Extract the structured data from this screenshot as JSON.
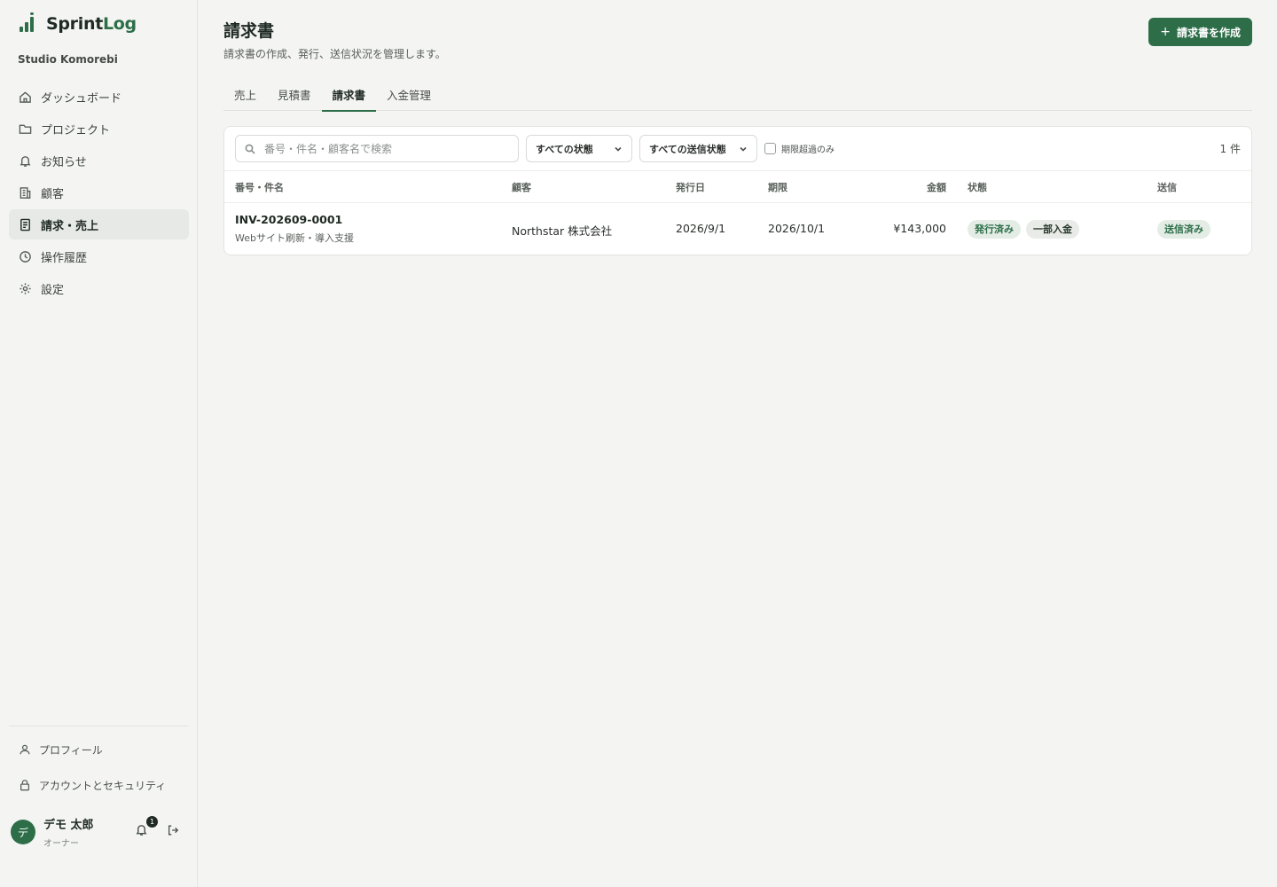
{
  "brand": {
    "name_part1": "Sprint",
    "name_part2": "Log",
    "org": "Studio Komorebi"
  },
  "nav": [
    {
      "label": "ダッシュボード",
      "icon": "home-icon"
    },
    {
      "label": "プロジェクト",
      "icon": "folder-icon"
    },
    {
      "label": "お知らせ",
      "icon": "bell-icon"
    },
    {
      "label": "顧客",
      "icon": "building-icon"
    },
    {
      "label": "請求・売上",
      "icon": "receipt-icon",
      "active": true
    },
    {
      "label": "操作履歴",
      "icon": "clock-icon"
    },
    {
      "label": "設定",
      "icon": "gear-icon"
    }
  ],
  "bottom_nav": [
    {
      "label": "プロフィール",
      "icon": "user-icon"
    },
    {
      "label": "アカウントとセキュリティ",
      "icon": "lock-icon"
    }
  ],
  "user": {
    "initial": "デ",
    "name": "デモ 太郎",
    "role": "オーナー",
    "notifications": "1"
  },
  "page": {
    "title": "請求書",
    "subtitle": "請求書の作成、発行、送信状況を管理します。",
    "create_button": "請求書を作成",
    "create_icon": "+"
  },
  "tabs": [
    {
      "label": "売上"
    },
    {
      "label": "見積書"
    },
    {
      "label": "請求書",
      "active": true
    },
    {
      "label": "入金管理"
    }
  ],
  "filters": {
    "search_placeholder": "番号・件名・顧客名で検索",
    "status_select": "すべての状態",
    "send_status_select": "すべての送信状態",
    "overdue_label": "期限超過のみ",
    "count": "1 件"
  },
  "table": {
    "headers": {
      "number": "番号・件名",
      "customer": "顧客",
      "issued": "発行日",
      "due": "期限",
      "amount": "金額",
      "status": "状態",
      "send": "送信"
    },
    "rows": [
      {
        "number": "INV-202609-0001",
        "title": "Webサイト刷新・導入支援",
        "customer": "Northstar 株式会社",
        "issued": "2026/9/1",
        "due": "2026/10/1",
        "amount": "¥143,000",
        "status_1": "発行済み",
        "status_2": "一部入金",
        "send": "送信済み"
      }
    ]
  },
  "colors": {
    "accent": "#2d6e49",
    "background": "#f4f5f3"
  }
}
